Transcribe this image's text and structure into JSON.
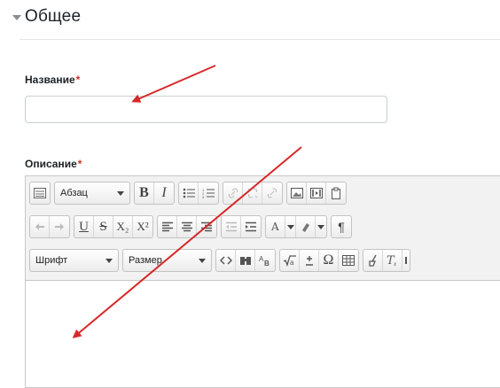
{
  "section": {
    "title": "Общее"
  },
  "name_field": {
    "label": "Название",
    "required_mark": "*",
    "value": ""
  },
  "description_field": {
    "label": "Описание",
    "required_mark": "*"
  },
  "editor": {
    "row1": {
      "paragraph_select": "Абзац",
      "bold": "B",
      "italic": "I"
    },
    "row2": {
      "underline": "U",
      "strike": "S",
      "subscript": "X₂",
      "superscript": "X²"
    },
    "row3": {
      "font_select": "Шрифт",
      "size_select": "Размер",
      "omega": "Ω",
      "pilcrow": "¶"
    }
  },
  "colors": {
    "required": "#ca3120",
    "arrow": "#d62828"
  }
}
